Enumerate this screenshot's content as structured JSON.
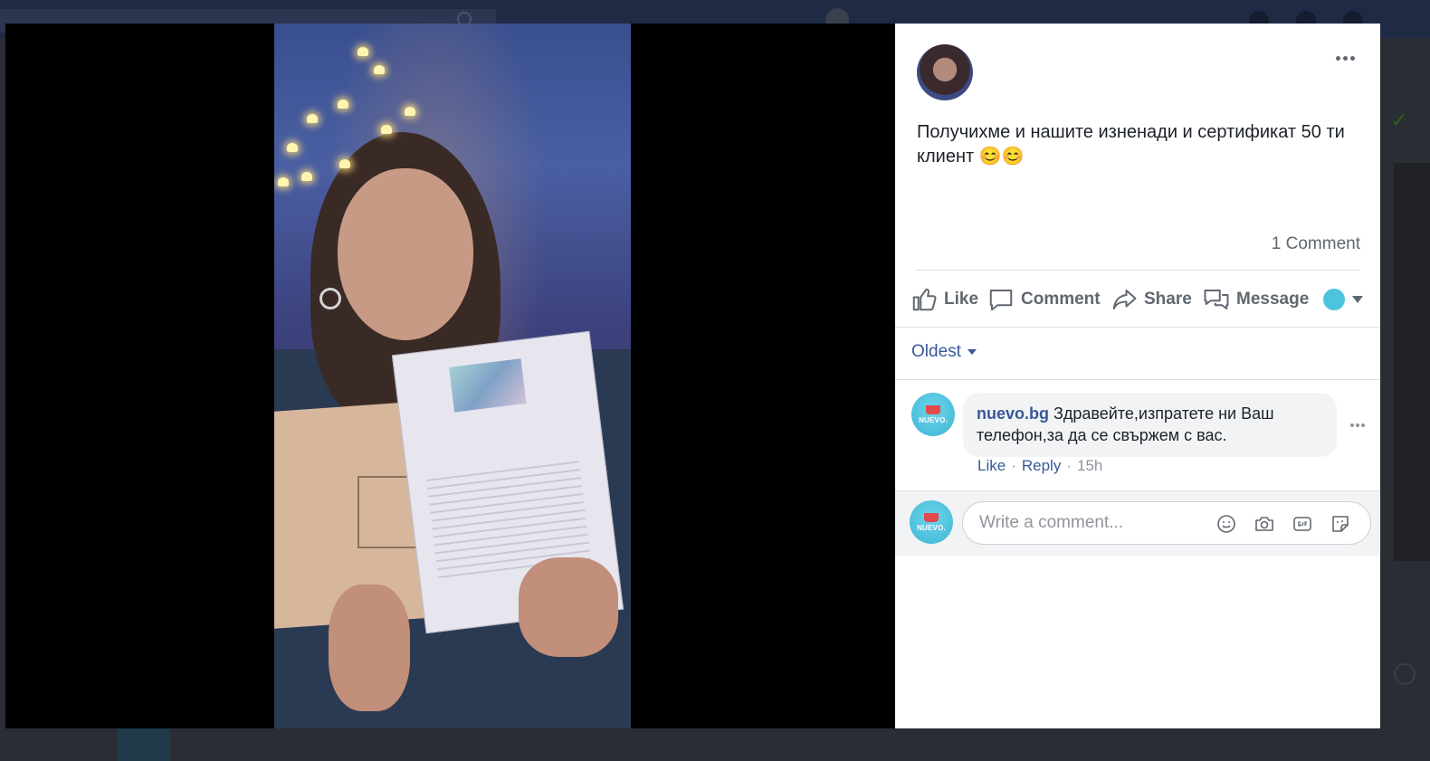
{
  "post": {
    "text": "Получихме и нашите изненади и сертификат 50 ти клиент 😊😊",
    "comment_count": "1 Comment"
  },
  "actions": {
    "like": "Like",
    "comment": "Comment",
    "share": "Share",
    "message": "Message"
  },
  "comments_filter": {
    "label": "Oldest"
  },
  "comments": [
    {
      "author": "nuevo.bg",
      "text": "Здравейте,изпратете ни Ваш телефон,за да се свържем с вас.",
      "like_label": "Like",
      "reply_label": "Reply",
      "time": "15h",
      "separator": "·"
    }
  ],
  "composer": {
    "placeholder": "Write a comment..."
  },
  "page_logo": {
    "text": "NUEVO."
  },
  "icons": [
    "more-dots-icon",
    "like-icon",
    "comment-icon",
    "share-icon",
    "message-icon",
    "caret-down-icon",
    "emoji-icon",
    "camera-icon",
    "gif-icon",
    "sticker-icon"
  ],
  "colors": {
    "link_blue": "#385898",
    "muted_gray": "#606770",
    "page_logo_cyan": "#4cc4e0"
  }
}
